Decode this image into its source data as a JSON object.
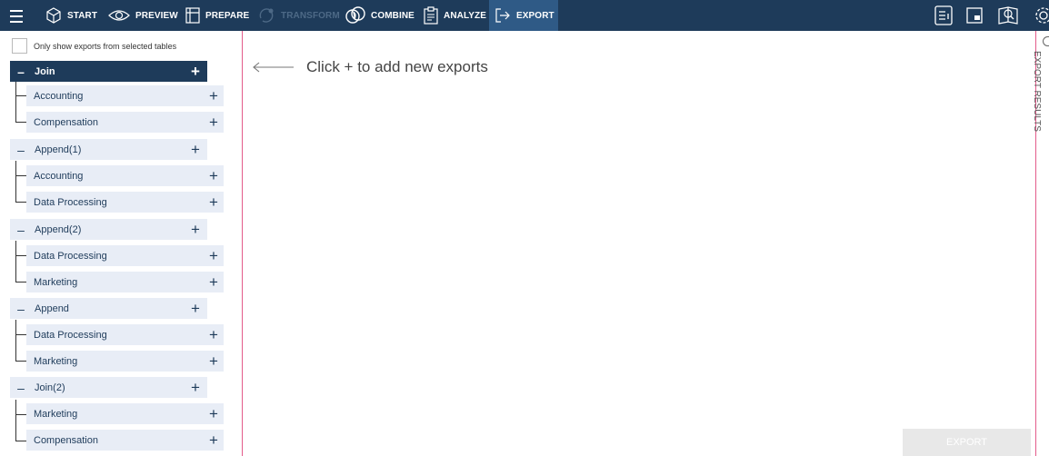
{
  "toolbar": {
    "menu_icon": "hamburger-menu-icon",
    "items": [
      {
        "label": "START",
        "icon": "cube-icon"
      },
      {
        "label": "PREVIEW",
        "icon": "eye-icon"
      },
      {
        "label": "PREPARE",
        "icon": "table-icon"
      },
      {
        "label": "TRANSFORM",
        "icon": "transform-icon",
        "disabled": true
      },
      {
        "label": "COMBINE",
        "icon": "combine-icon"
      },
      {
        "label": "ANALYZE",
        "icon": "clipboard-icon"
      },
      {
        "label": "EXPORT",
        "icon": "export-arrow-icon",
        "active": true
      }
    ],
    "colors": {
      "bar": "#1e3b5a",
      "active": "#2f5a86",
      "disabled_text": "#4d6986"
    }
  },
  "filter": {
    "label": "Only show exports from selected tables",
    "checked": false
  },
  "groups": [
    {
      "label": "Join",
      "selected": true,
      "children": [
        "Accounting",
        "Compensation"
      ]
    },
    {
      "label": "Append(1)",
      "children": [
        "Accounting",
        "Data Processing"
      ]
    },
    {
      "label": "Append(2)",
      "children": [
        "Data Processing",
        "Marketing"
      ]
    },
    {
      "label": "Append",
      "children": [
        "Data Processing",
        "Marketing"
      ]
    },
    {
      "label": "Join(2)",
      "children": [
        "Marketing",
        "Compensation"
      ]
    }
  ],
  "symbols": {
    "minus": "–",
    "plus": "+"
  },
  "main": {
    "hint": "Click + to add new exports",
    "export_button": "EXPORT"
  },
  "side_panel": {
    "label": "EXPORT RESULTS"
  }
}
